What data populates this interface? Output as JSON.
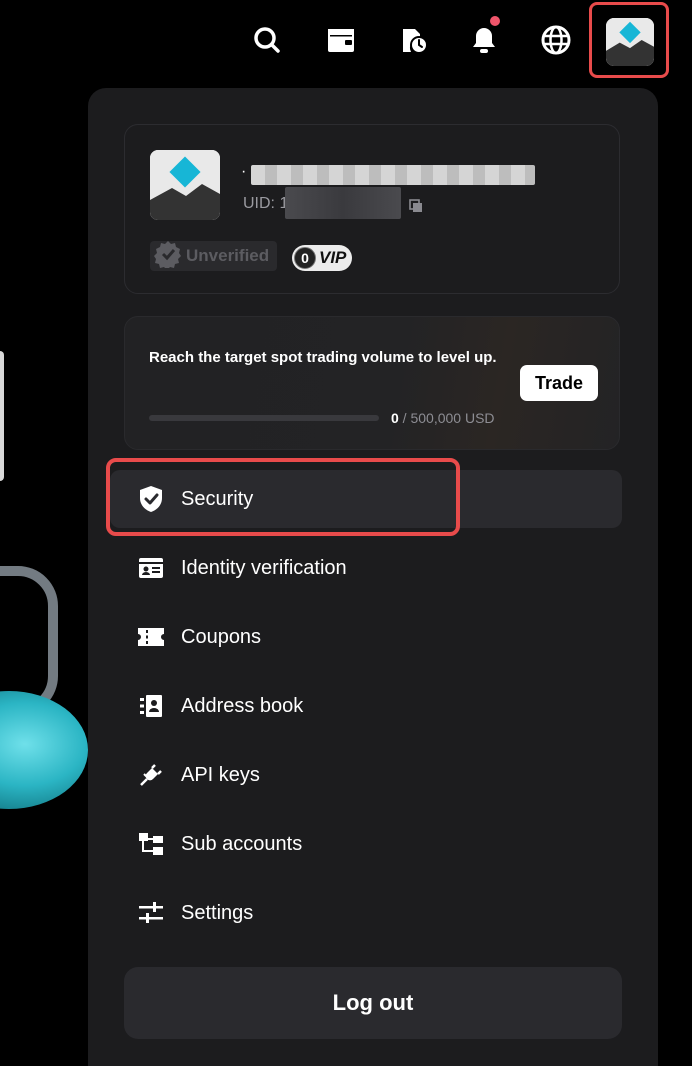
{
  "profile": {
    "prefix": "·",
    "uid_label": "UID: 1",
    "status": "Unverified",
    "vip_level": "0",
    "vip_label": "VIP"
  },
  "level": {
    "message": "Reach the target spot trading volume to level up.",
    "progress_current": "0",
    "progress_target": " / 500,000 USD",
    "progress_fraction": 0,
    "trade_label": "Trade"
  },
  "menu": {
    "items": [
      {
        "label": "Security",
        "icon": "shield-check-icon"
      },
      {
        "label": "Identity verification",
        "icon": "id-card-icon"
      },
      {
        "label": "Coupons",
        "icon": "ticket-icon"
      },
      {
        "label": "Address book",
        "icon": "address-book-icon"
      },
      {
        "label": "API keys",
        "icon": "plug-icon"
      },
      {
        "label": "Sub accounts",
        "icon": "hierarchy-icon"
      },
      {
        "label": "Settings",
        "icon": "sliders-icon"
      }
    ]
  },
  "logout_label": "Log out",
  "topbar_icons": [
    "search-icon",
    "wallet-icon",
    "history-icon",
    "bell-icon",
    "globe-icon",
    "avatar"
  ],
  "colors": {
    "panel": "#1c1c1e",
    "highlight": "#e84b4b",
    "notification": "#f0556b",
    "brand_diamond": "#17b6d6"
  }
}
